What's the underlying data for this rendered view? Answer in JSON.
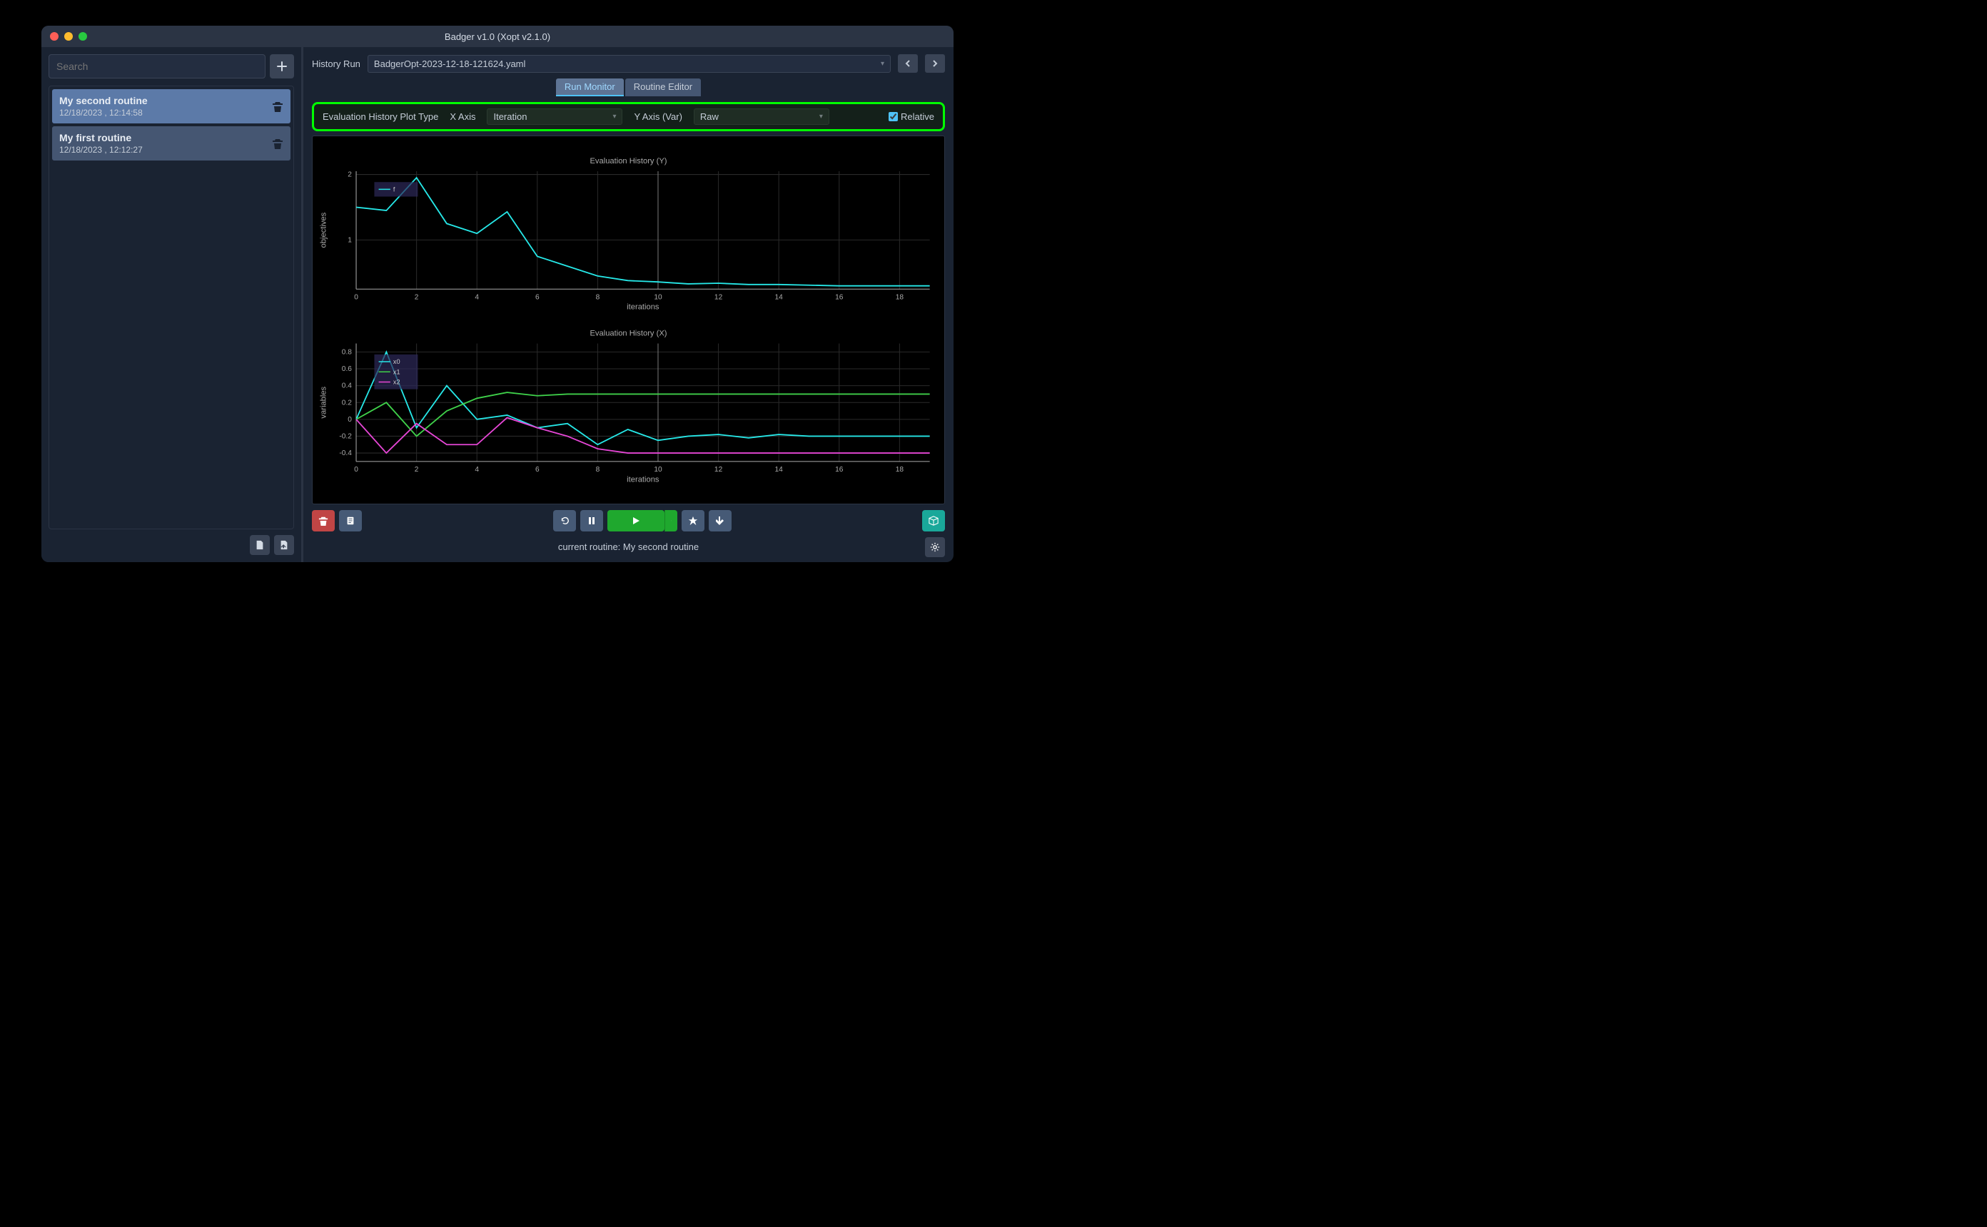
{
  "window_title": "Badger v1.0 (Xopt v2.1.0)",
  "sidebar": {
    "search_placeholder": "Search",
    "routines": [
      {
        "name": "My second routine",
        "date": "12/18/2023 , 12:14:58",
        "selected": true
      },
      {
        "name": "My first routine",
        "date": "12/18/2023 , 12:12:27",
        "selected": false
      }
    ]
  },
  "history_run": {
    "label": "History Run",
    "value": "BadgerOpt-2023-12-18-121624.yaml"
  },
  "tabs": {
    "run_monitor": "Run Monitor",
    "routine_editor": "Routine Editor",
    "active": "run_monitor"
  },
  "plot_controls": {
    "title": "Evaluation History Plot Type",
    "x_axis_label": "X Axis",
    "x_axis_value": "Iteration",
    "y_axis_label": "Y Axis (Var)",
    "y_axis_value": "Raw",
    "relative_label": "Relative",
    "relative_checked": true
  },
  "status": {
    "text": "current routine: My second routine"
  },
  "chart_data": [
    {
      "type": "line",
      "title": "Evaluation History (Y)",
      "xlabel": "iterations",
      "ylabel": "objectives",
      "x_ticks": [
        0,
        2,
        4,
        6,
        8,
        10,
        12,
        14,
        16,
        18
      ],
      "y_ticks": [
        1,
        2
      ],
      "xlim": [
        0,
        19
      ],
      "ylim": [
        0.25,
        2.05
      ],
      "series": [
        {
          "name": "f",
          "color": "#26e8e8",
          "x": [
            0,
            1,
            2,
            3,
            4,
            5,
            6,
            7,
            8,
            9,
            10,
            11,
            12,
            13,
            14,
            15,
            16,
            17,
            18,
            19
          ],
          "values": [
            1.5,
            1.45,
            1.95,
            1.25,
            1.1,
            1.43,
            0.75,
            0.6,
            0.45,
            0.38,
            0.36,
            0.33,
            0.34,
            0.32,
            0.32,
            0.31,
            0.3,
            0.3,
            0.3,
            0.3
          ]
        }
      ]
    },
    {
      "type": "line",
      "title": "Evaluation History (X)",
      "xlabel": "iterations",
      "ylabel": "variables",
      "x_ticks": [
        0,
        2,
        4,
        6,
        8,
        10,
        12,
        14,
        16,
        18
      ],
      "y_ticks": [
        -0.4,
        -0.2,
        0,
        0.2,
        0.4,
        0.6,
        0.8
      ],
      "xlim": [
        0,
        19
      ],
      "ylim": [
        -0.5,
        0.9
      ],
      "series": [
        {
          "name": "x0",
          "color": "#26e8e8",
          "x": [
            0,
            1,
            2,
            3,
            4,
            5,
            6,
            7,
            8,
            9,
            10,
            11,
            12,
            13,
            14,
            15,
            16,
            17,
            18,
            19
          ],
          "values": [
            0.0,
            0.8,
            -0.1,
            0.4,
            0.0,
            0.05,
            -0.1,
            -0.05,
            -0.3,
            -0.12,
            -0.25,
            -0.2,
            -0.18,
            -0.22,
            -0.18,
            -0.2,
            -0.2,
            -0.2,
            -0.2,
            -0.2
          ]
        },
        {
          "name": "x1",
          "color": "#3fd14a",
          "x": [
            0,
            1,
            2,
            3,
            4,
            5,
            6,
            7,
            8,
            9,
            10,
            11,
            12,
            13,
            14,
            15,
            16,
            17,
            18,
            19
          ],
          "values": [
            0.0,
            0.2,
            -0.2,
            0.1,
            0.25,
            0.32,
            0.28,
            0.3,
            0.3,
            0.3,
            0.3,
            0.3,
            0.3,
            0.3,
            0.3,
            0.3,
            0.3,
            0.3,
            0.3,
            0.3
          ]
        },
        {
          "name": "x2",
          "color": "#e646d6",
          "x": [
            0,
            1,
            2,
            3,
            4,
            5,
            6,
            7,
            8,
            9,
            10,
            11,
            12,
            13,
            14,
            15,
            16,
            17,
            18,
            19
          ],
          "values": [
            0.0,
            -0.4,
            -0.05,
            -0.3,
            -0.3,
            0.02,
            -0.1,
            -0.2,
            -0.35,
            -0.4,
            -0.4,
            -0.4,
            -0.4,
            -0.4,
            -0.4,
            -0.4,
            -0.4,
            -0.4,
            -0.4,
            -0.4
          ]
        }
      ]
    }
  ]
}
